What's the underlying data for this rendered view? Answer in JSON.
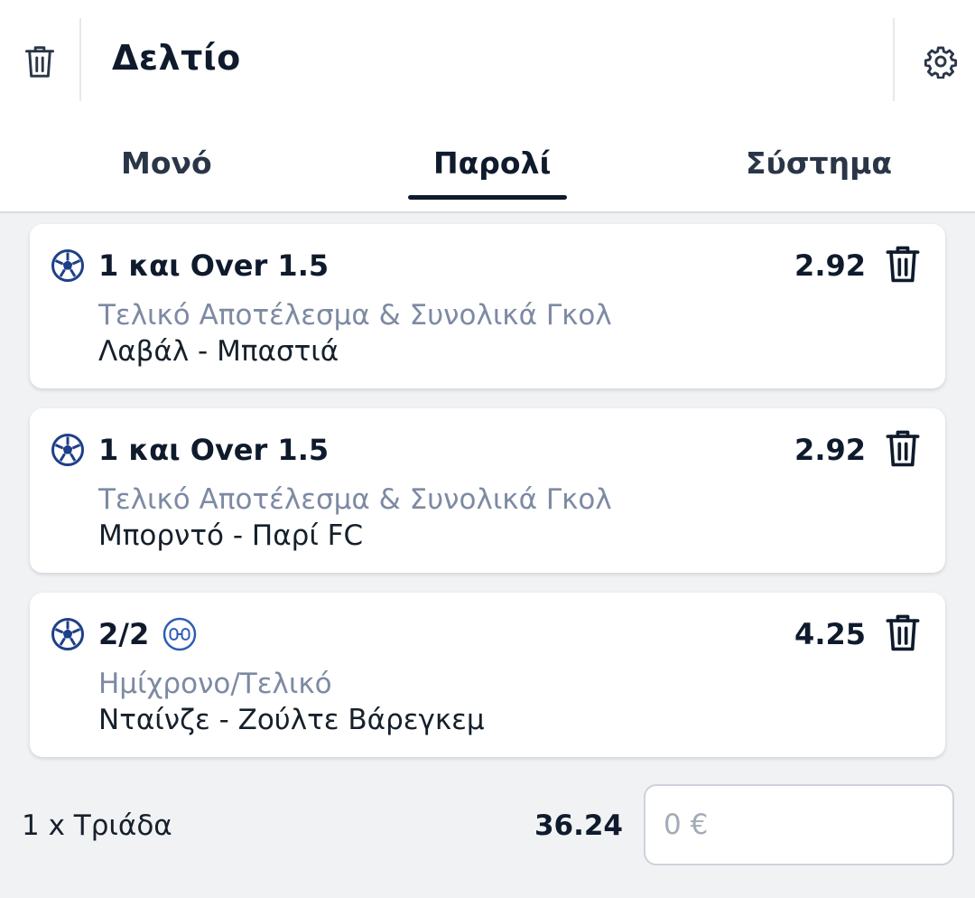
{
  "header": {
    "title": "Δελτίο",
    "icons": {
      "clear_all": "trash-icon",
      "settings": "gear-icon"
    }
  },
  "tabs": [
    {
      "label": "Μονό",
      "active": false
    },
    {
      "label": "Παρολί",
      "active": true
    },
    {
      "label": "Σύστημα",
      "active": false
    }
  ],
  "bets": [
    {
      "sport_icon": "football-icon",
      "selection": "1 και Over 1.5",
      "odds": "2.92",
      "market": "Τελικό Αποτέλεσμα & Συνολικά Γκολ",
      "match": "Λαβάλ - Μπαστιά"
    },
    {
      "sport_icon": "football-icon",
      "selection": "1 και Over 1.5",
      "odds": "2.92",
      "market": "Τελικό Αποτέλεσμα & Συνολικά Γκολ",
      "match": "Μπορντό - Παρί FC"
    },
    {
      "sport_icon": "football-icon",
      "selection": "2/2",
      "extra_icon": "halftime-score-icon",
      "odds": "4.25",
      "market": "Ημίχρονο/Τελικό",
      "match": "Νταίνζε - Ζούλτε Βάρεγκεμ"
    }
  ],
  "footer": {
    "bet_type": "1 x Τριάδα",
    "total_odds": "36.24",
    "stake_placeholder": "0 €"
  },
  "colors": {
    "primary_text": "#0f1b2d",
    "muted_text": "#7d8aa3",
    "icon_blue": "#1f3f8a",
    "background": "#f1f2f4"
  }
}
